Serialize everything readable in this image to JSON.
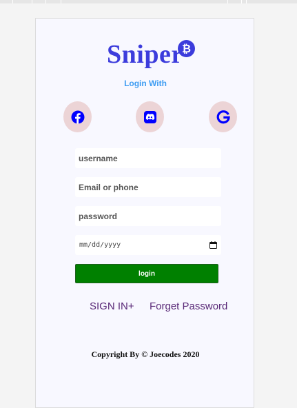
{
  "brand": {
    "name": "Sniper",
    "badge_icon": "bitcoin-icon",
    "badge_symbol": "₿",
    "color": "#3c3cdc"
  },
  "login_with": "Login With",
  "social": [
    {
      "name": "facebook",
      "icon": "facebook-icon",
      "color": "#0000ff"
    },
    {
      "name": "discord",
      "icon": "discord-icon",
      "color": "#0000ff"
    },
    {
      "name": "google",
      "icon": "google-icon",
      "color": "#0000ff"
    }
  ],
  "form": {
    "username_placeholder": "username",
    "email_placeholder": "Email or phone",
    "password_placeholder": "password",
    "date_placeholder": "mm/dd/yyyy",
    "login_label": "login",
    "login_color": "#008000"
  },
  "links": {
    "sign_in": "SIGN IN+",
    "forget_password": "Forget Password"
  },
  "footer": {
    "copyright": "Copyright By © Joecodes 2020"
  }
}
